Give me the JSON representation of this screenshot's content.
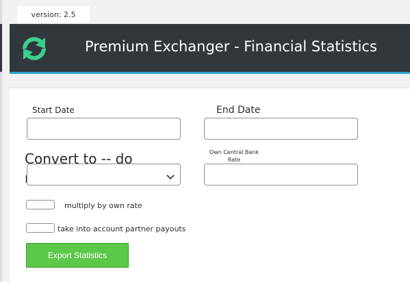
{
  "app": {
    "version": "version: 2.5",
    "title": "Premium Exchanger - Financial Statistics"
  },
  "form": {
    "start_date_label": "Start Date",
    "start_date_value": "",
    "end_date_label": "End Date",
    "end_date_value": "",
    "convert_label": "Convert to -- do not convert -",
    "convert_selected": "",
    "own_rate_label": "Own Central Bank Rate",
    "own_rate_value": "",
    "multiply_label": "multiply by own rate",
    "multiply_checked": false,
    "partner_label": "take into account partner payouts",
    "partner_checked": false,
    "export_label": "Export Statistics"
  },
  "colors": {
    "header_bg": "#32373c",
    "header_accent": "#2ea2cc",
    "logo_green": "#3ccf8e",
    "export_green": "#5cc84a"
  },
  "icons": {
    "logo": "refresh-arrows-icon",
    "select": "chevron-down-icon"
  }
}
